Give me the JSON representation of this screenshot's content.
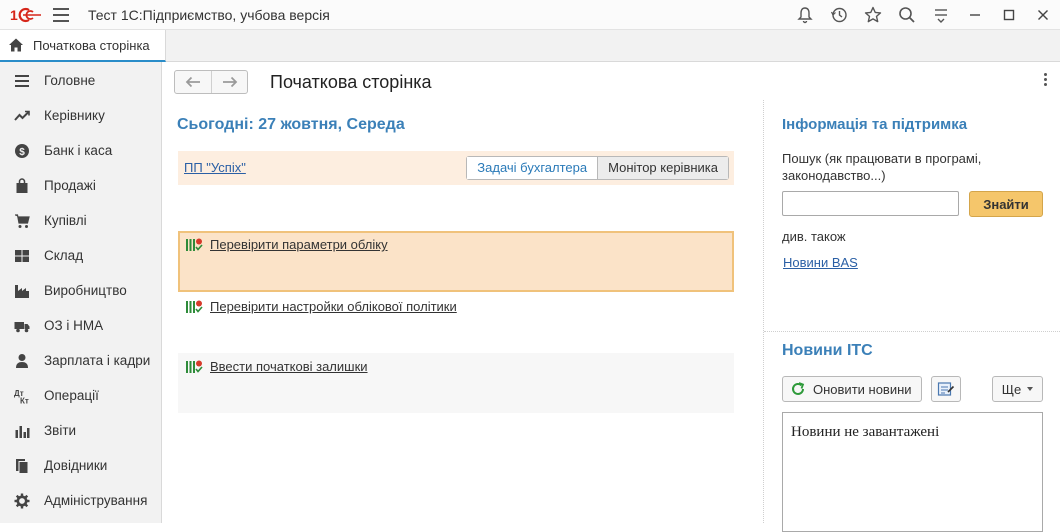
{
  "titlebar": {
    "logo": "1C",
    "app_title": "Тест 1С:Підприємство, учбова версія",
    "icons": [
      "bell-icon",
      "history-icon",
      "star-icon",
      "search-icon",
      "settings-lines-icon",
      "minimize-icon",
      "maximize-icon",
      "close-icon"
    ]
  },
  "tabs": {
    "home_label": "Початкова сторінка"
  },
  "sidebar": {
    "items": [
      {
        "label": "Головне",
        "icon": "menu-list-icon"
      },
      {
        "label": "Керівнику",
        "icon": "trend-icon"
      },
      {
        "label": "Банк і каса",
        "icon": "coin-icon"
      },
      {
        "label": "Продажі",
        "icon": "bag-icon"
      },
      {
        "label": "Купівлі",
        "icon": "cart-icon"
      },
      {
        "label": "Склад",
        "icon": "grid-icon"
      },
      {
        "label": "Виробництво",
        "icon": "factory-icon"
      },
      {
        "label": "ОЗ і НМА",
        "icon": "truck-icon"
      },
      {
        "label": "Зарплата і кадри",
        "icon": "person-icon"
      },
      {
        "label": "Операції",
        "icon": "dt-kt-icon"
      },
      {
        "label": "Звіти",
        "icon": "bar-chart-icon"
      },
      {
        "label": "Довідники",
        "icon": "books-icon"
      },
      {
        "label": "Адміністрування",
        "icon": "gear-icon"
      }
    ]
  },
  "main": {
    "page_title": "Початкова сторінка",
    "today": "Сьогодні: 27 жовтня, Середа",
    "org_link": "ПП \"Успіх\"",
    "seg_tabs": {
      "accountant": "Задачі бухгалтера",
      "monitor": "Монітор керівника"
    },
    "tasks": [
      {
        "label": "Перевірити параметри обліку"
      },
      {
        "label": "Перевірити настройки облікової політики"
      },
      {
        "label": "Ввести початкові залишки"
      }
    ]
  },
  "info": {
    "title": "Інформація та підтримка",
    "search_hint": "Пошук (як працювати в програмі, законодавство...)",
    "search_value": "",
    "find_label": "Знайти",
    "see_also": "див. також",
    "news_bas": "Новини BAS"
  },
  "itc": {
    "title": "Новини ІТС",
    "refresh_label": "Оновити новини",
    "more_label": "Ще",
    "news_text": "Новини не завантажені"
  },
  "colors": {
    "accent_blue": "#3b80b8",
    "link_blue": "#2a5fa5",
    "find_button": "#f5c66b",
    "org_bar": "#fdeee0",
    "task_highlight": "#fbe3c8"
  }
}
